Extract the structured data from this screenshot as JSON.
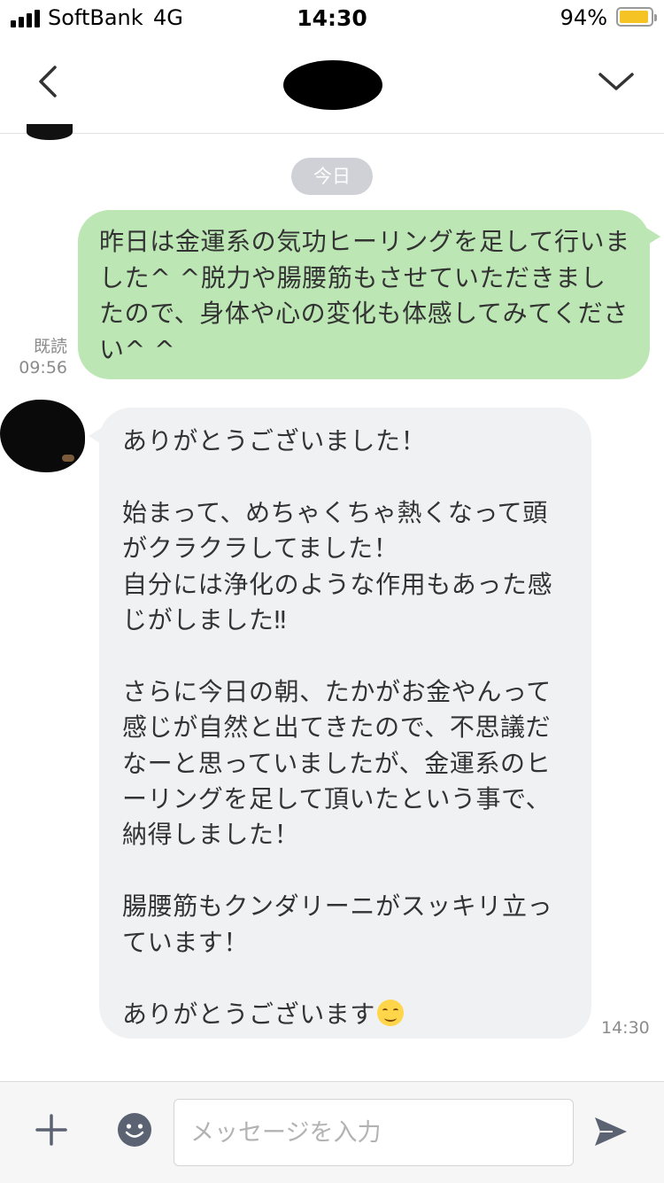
{
  "status_bar": {
    "carrier": "SoftBank",
    "network": "4G",
    "time": "14:30",
    "battery_percent": "94%",
    "battery_level": 0.94,
    "battery_color": "#f5c323"
  },
  "header": {
    "back_icon": "chevron-left-icon",
    "menu_icon": "chevron-down-icon"
  },
  "chat": {
    "date_label": "今日",
    "outgoing": {
      "text": "昨日は金運系の気功ヒーリングを足して行いました^ ^脱力や腸腰筋もさせていただきましたので、身体や心の変化も体感してみてください^ ^",
      "read_label": "既読",
      "time": "09:56",
      "bubble_color": "#bce6b4"
    },
    "incoming": {
      "text": "ありがとうございました！\n\n始まって、めちゃくちゃ熱くなって頭がクラクラしてました！\n自分には浄化のような作用もあった感じがしました‼\n\nさらに今日の朝、たかがお金やんって感じが自然と出てきたので、不思議だなーと思っていましたが、金運系のヒーリングを足して頂いたという事で、納得しました！\n\n腸腰筋もクンダリーニがスッキリ立っています！\n\nありがとうございます",
      "emoji": "smiling-face-emoji",
      "time": "14:30",
      "bubble_color": "#f0f1f3"
    }
  },
  "input_bar": {
    "placeholder": "メッセージを入力",
    "value": "",
    "plus_icon": "plus-icon",
    "sticker_icon": "smiley-icon",
    "send_icon": "send-icon"
  }
}
